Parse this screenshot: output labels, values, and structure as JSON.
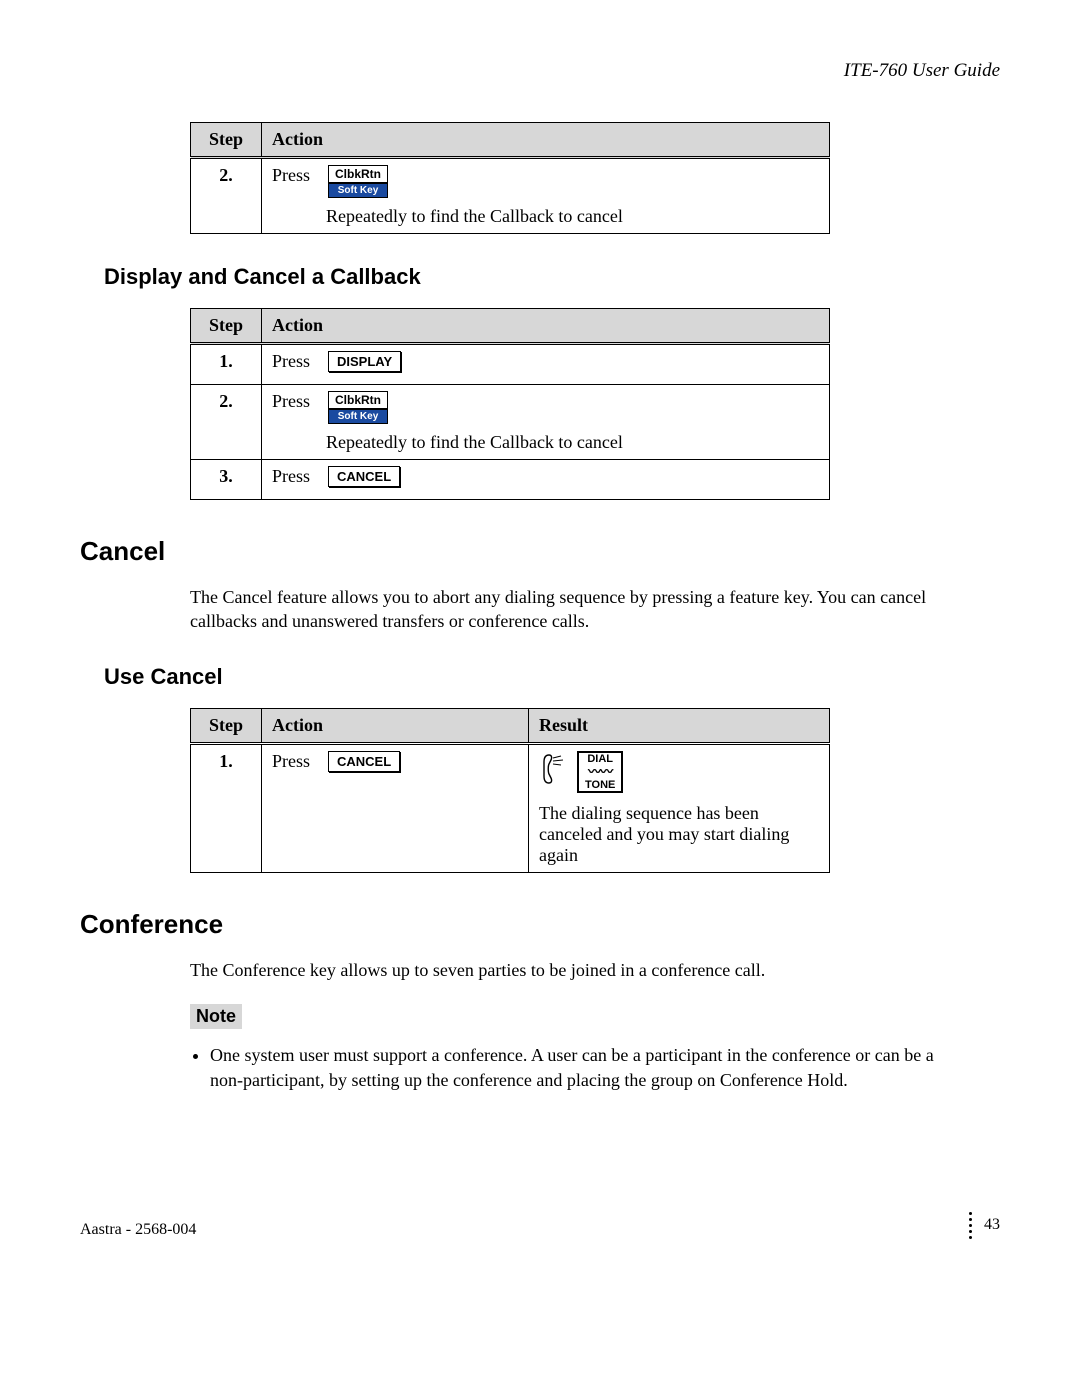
{
  "header": {
    "doc_title": "ITE-760 User Guide"
  },
  "labels": {
    "step": "Step",
    "action": "Action",
    "result": "Result",
    "press": "Press",
    "softkey": "Soft Key",
    "note": "Note"
  },
  "table1": {
    "rows": [
      {
        "step": "2.",
        "btn": "ClbkRtn",
        "is_softkey": true,
        "desc": "Repeatedly to find the Callback to cancel"
      }
    ]
  },
  "section_display": {
    "heading": "Display and Cancel a Callback",
    "rows": [
      {
        "step": "1.",
        "btn": "DISPLAY",
        "is_softkey": false,
        "desc": ""
      },
      {
        "step": "2.",
        "btn": "ClbkRtn",
        "is_softkey": true,
        "desc": "Repeatedly to find the Callback to cancel"
      },
      {
        "step": "3.",
        "btn": "CANCEL",
        "is_softkey": false,
        "desc": ""
      }
    ]
  },
  "section_cancel": {
    "heading": "Cancel",
    "intro": "The Cancel feature allows you to abort any dialing sequence by pressing a feature key. You can cancel callbacks and unanswered transfers or conference calls."
  },
  "section_use_cancel": {
    "heading": "Use Cancel",
    "rows": [
      {
        "step": "1.",
        "btn": "CANCEL",
        "is_softkey": false,
        "result_label_top": "DIAL",
        "result_label_bot": "TONE",
        "result_text": "The dialing sequence has been canceled and you may start dialing again"
      }
    ]
  },
  "section_conference": {
    "heading": "Conference",
    "intro": "The Conference key allows up to seven parties to be joined in a conference call.",
    "note_items": [
      "One system user must support a conference.  A user can be a participant in the conference or can be a non-participant, by setting up the conference and placing the group on Conference Hold."
    ]
  },
  "footer": {
    "left": "Aastra - 2568-004",
    "page": "43"
  }
}
